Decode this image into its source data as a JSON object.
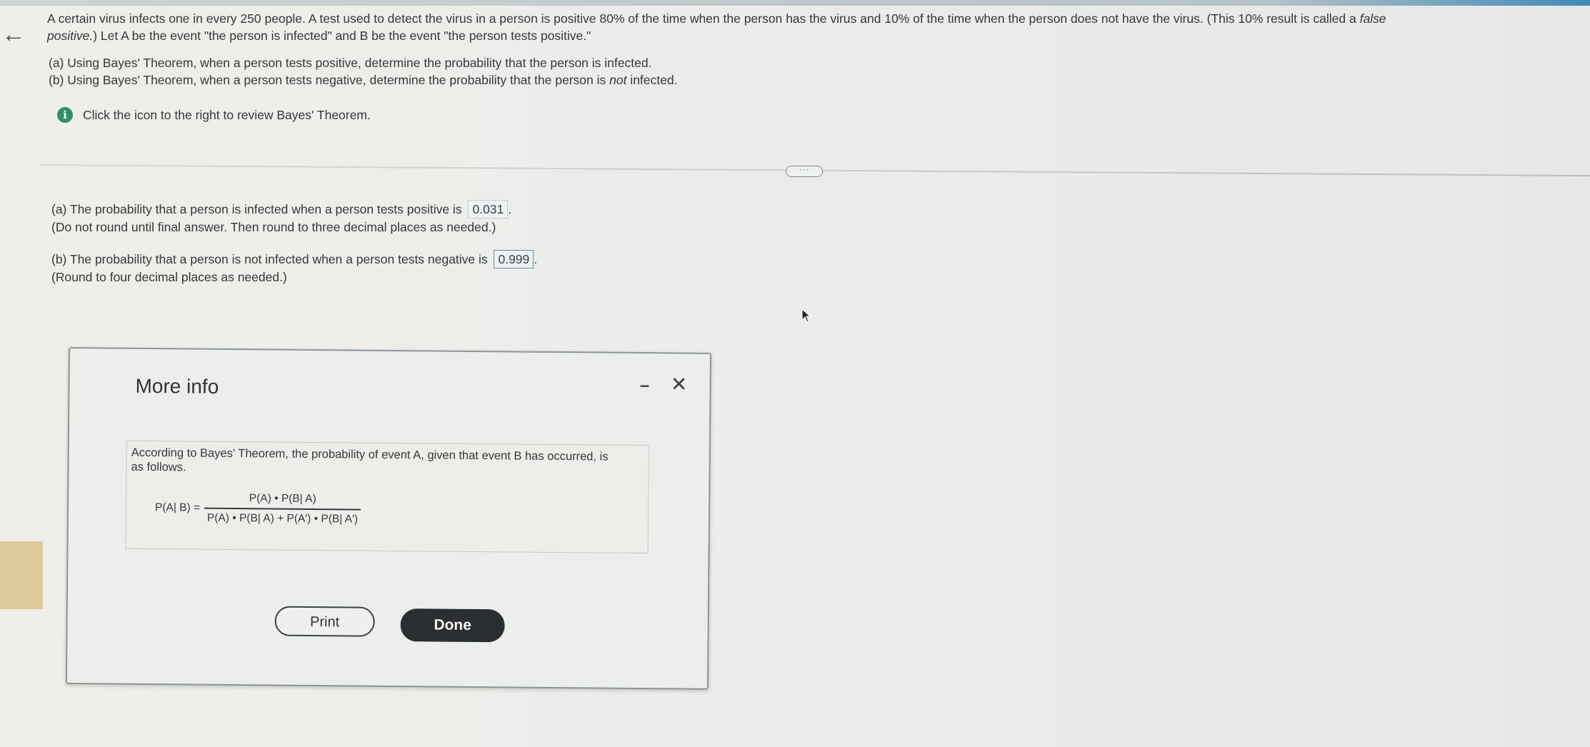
{
  "nav": {
    "back_icon": "back-arrow-icon"
  },
  "question": {
    "line1": "A certain virus infects one in every 250 people. A test used to detect the virus in a person is positive 80% of the time when the person has the virus and 10% of the time when the person does not have the virus. (This 10% result is called a false",
    "line2": "positive.) Let A be the event \"the person is infected\" and B be the event \"the person tests positive.\"",
    "part_a": "(a) Using Bayes' Theorem, when a person tests positive, determine the probability that the person is infected.",
    "part_b": "(b) Using Bayes' Theorem, when a person tests negative, determine the probability that the person is not infected.",
    "hint": "Click the icon to the right to review Bayes' Theorem.",
    "info_icon": "info-icon"
  },
  "answers": {
    "a_prompt": "(a) The probability that a person is infected when a person tests positive is",
    "a_value": "0.031",
    "a_suffix": ".",
    "a_note": "(Do not round until final answer. Then round to three decimal places as needed.)",
    "b_prompt": "(b) The probability that a person is not infected when a person tests negative is",
    "b_value": "0.999",
    "b_suffix": ".",
    "b_note": "(Round to four decimal places as needed.)"
  },
  "modal": {
    "title": "More info",
    "minimize_label": "–",
    "close_label": "✕",
    "theorem_text": "According to Bayes' Theorem, the probability of event A, given that event B has occurred, is as follows.",
    "formula_lhs": "P(A| B) =",
    "formula_numerator": "P(A) • P(B| A)",
    "formula_denominator": "P(A) • P(B| A) + P(A′) • P(B| A′)",
    "print_label": "Print",
    "done_label": "Done"
  },
  "colors": {
    "accent": "#2f8e6a",
    "done_button": "#2a2e31"
  }
}
